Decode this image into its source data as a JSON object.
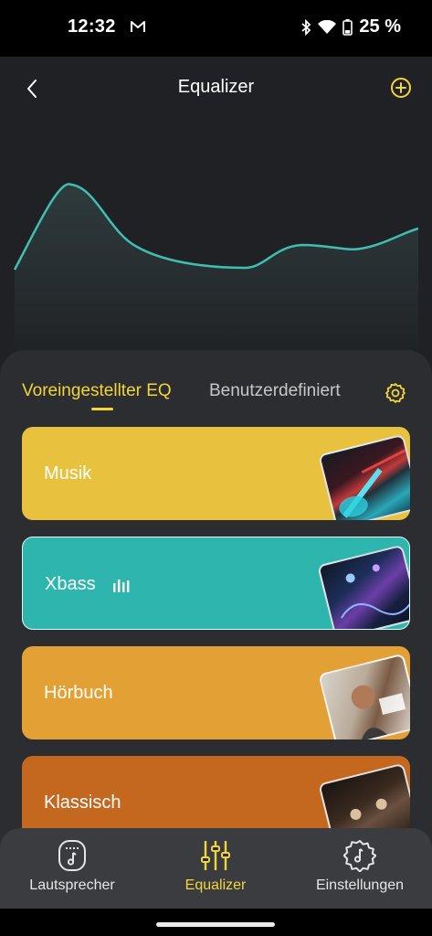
{
  "status_bar": {
    "time": "12:32",
    "battery": "25 %",
    "icons": [
      "gmail-icon",
      "bluetooth-icon",
      "wifi-icon",
      "battery-icon"
    ]
  },
  "header": {
    "title": "Equalizer",
    "back_icon": "chevron-left-icon",
    "add_icon": "plus-circle-icon"
  },
  "colors": {
    "accent": "#f2d53a",
    "curve": "#3fbfb2",
    "panel": "#2b2d31",
    "card_musik": "#e8c23e",
    "card_xbass": "#2eb5ad",
    "card_hoerbuch": "#e3a035",
    "card_klassisch": "#c4681f"
  },
  "tabs": {
    "preset": "Voreingestellter EQ",
    "custom": "Benutzerdefiniert"
  },
  "presets": [
    {
      "label": "Musik",
      "selected": false
    },
    {
      "label": "Xbass",
      "selected": true
    },
    {
      "label": "Hörbuch",
      "selected": false
    },
    {
      "label": "Klassisch",
      "selected": false
    }
  ],
  "bottom_nav": [
    {
      "label": "Lautsprecher",
      "icon": "speaker-icon",
      "active": false
    },
    {
      "label": "Equalizer",
      "icon": "sliders-icon",
      "active": true
    },
    {
      "label": "Einstellungen",
      "icon": "settings-gear-icon",
      "active": false
    }
  ]
}
